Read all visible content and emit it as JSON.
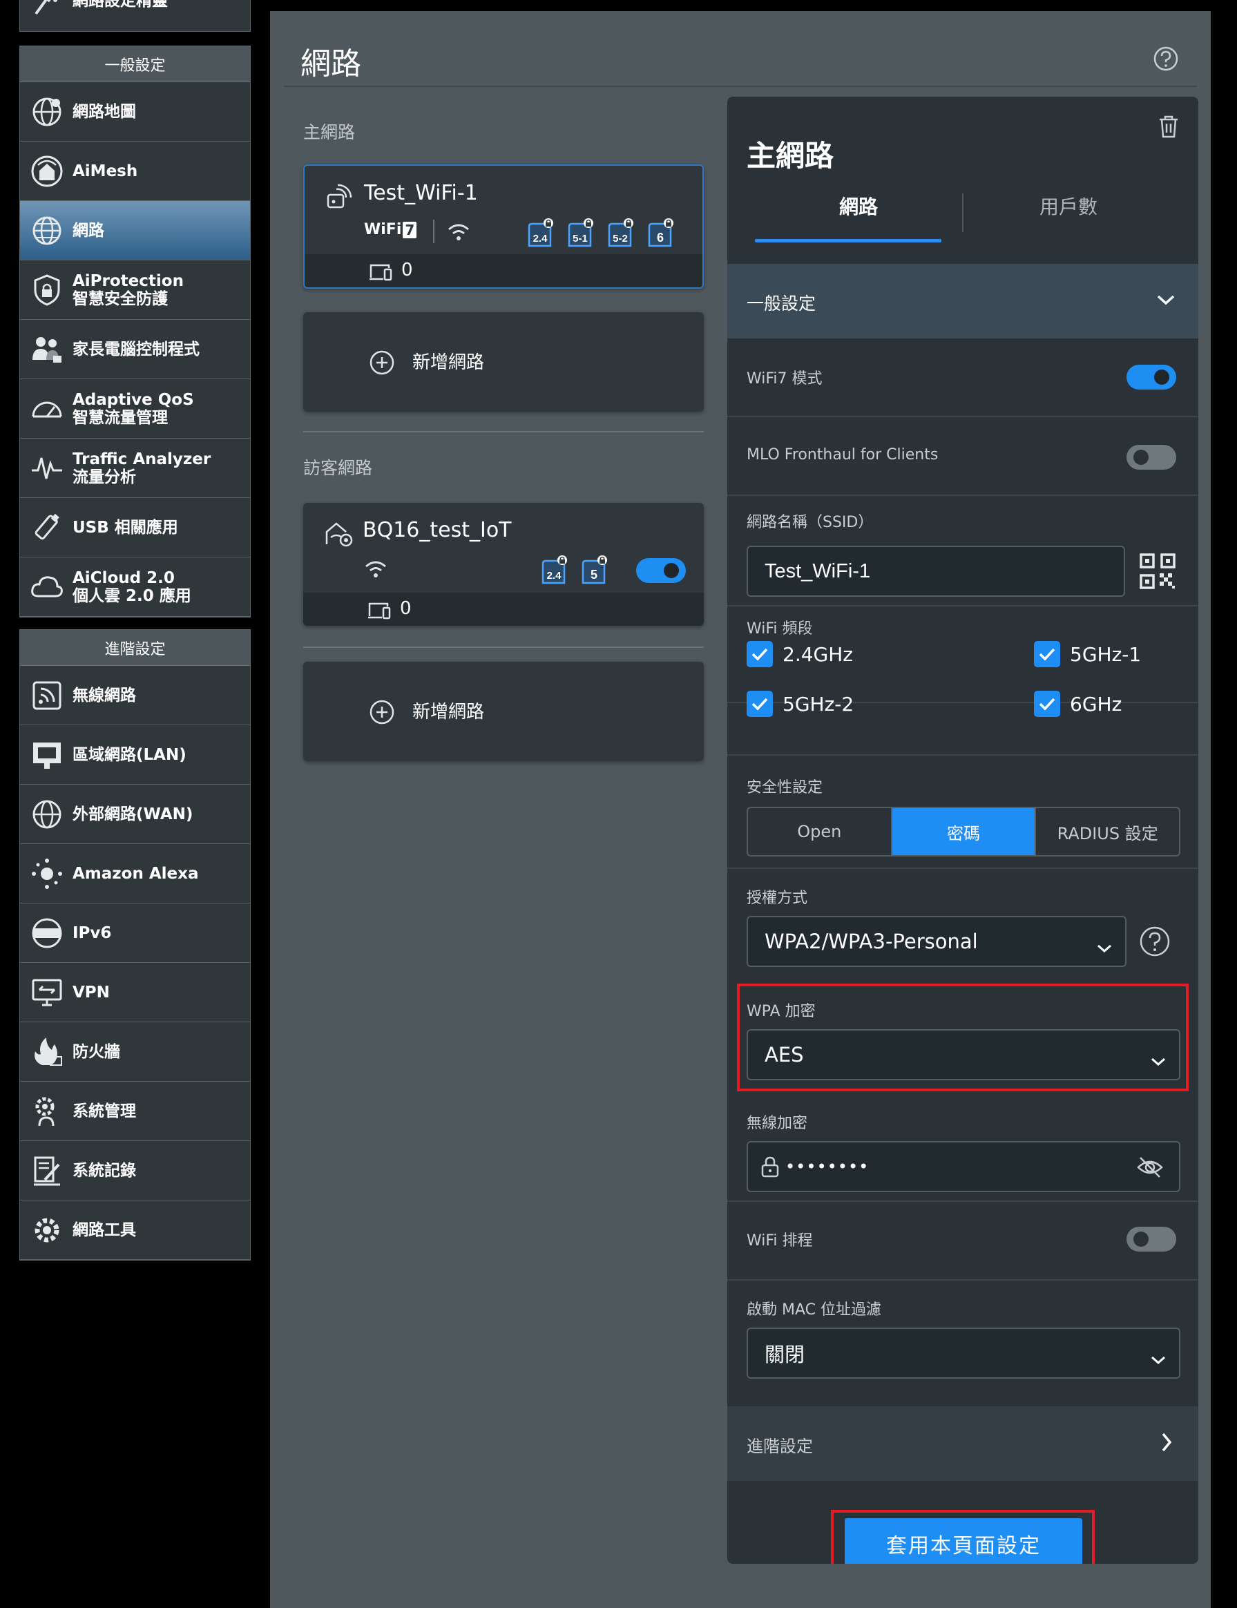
{
  "sidebar": {
    "top_partial_label": "網路設定精靈",
    "general_header": "一般設定",
    "general_items": [
      {
        "label": "網路地圖",
        "label2": ""
      },
      {
        "label": "AiMesh",
        "label2": ""
      },
      {
        "label": "網路",
        "label2": ""
      },
      {
        "label": "AiProtection",
        "label2": "智慧安全防護"
      },
      {
        "label": "家長電腦控制程式",
        "label2": ""
      },
      {
        "label": "Adaptive QoS",
        "label2": "智慧流量管理"
      },
      {
        "label": "Traffic Analyzer",
        "label2": "流量分析"
      },
      {
        "label": "USB 相關應用",
        "label2": ""
      },
      {
        "label": "AiCloud 2.0",
        "label2": "個人雲 2.0 應用"
      }
    ],
    "advanced_header": "進階設定",
    "advanced_items": [
      {
        "label": "無線網路"
      },
      {
        "label": "區域網路(LAN)"
      },
      {
        "label": "外部網路(WAN)"
      },
      {
        "label": "Amazon Alexa"
      },
      {
        "label": "IPv6"
      },
      {
        "label": "VPN"
      },
      {
        "label": "防火牆"
      },
      {
        "label": "系統管理"
      },
      {
        "label": "系統記錄"
      },
      {
        "label": "網路工具"
      }
    ]
  },
  "main": {
    "title": "網路",
    "main_network_label": "主網路",
    "guest_network_label": "訪客網路",
    "add_network_label": "新增網路",
    "main_card": {
      "ssid": "Test_WiFi-1",
      "wifi_badge": "WiFi",
      "wifi_badge_num": "7",
      "bands": [
        "2.4",
        "5-1",
        "5-2",
        "6"
      ],
      "client_count": "0"
    },
    "guest_card": {
      "ssid": "BQ16_test_IoT",
      "bands": [
        "2.4",
        "5"
      ],
      "client_count": "0",
      "enabled": true
    }
  },
  "settings": {
    "title": "主網路",
    "tab_network": "網路",
    "tab_users": "用戶數",
    "general_section": "一般設定",
    "wifi7_mode_label": "WiFi7 模式",
    "wifi7_mode_on": true,
    "mlo_label": "MLO Fronthaul for Clients",
    "mlo_on": false,
    "ssid_label": "網路名稱（SSID）",
    "ssid_value": "Test_WiFi-1",
    "band_label": "WiFi 頻段",
    "band_options": [
      "2.4GHz",
      "5GHz-1",
      "5GHz-2",
      "6GHz"
    ],
    "security_label": "安全性設定",
    "security_options": [
      "Open",
      "密碼",
      "RADIUS 設定"
    ],
    "auth_label": "授權方式",
    "auth_value": "WPA2/WPA3-Personal",
    "wpa_label": "WPA 加密",
    "wpa_value": "AES",
    "wireless_key_label": "無線加密",
    "wireless_key_value": "••••••••",
    "schedule_label": "WiFi 排程",
    "schedule_on": false,
    "mac_filter_label": "啟動 MAC 位址過濾",
    "mac_filter_value": "關閉",
    "advanced_label": "進階設定",
    "apply_label": "套用本頁面設定"
  },
  "colors": {
    "accent": "#1f8ef4",
    "highlight": "#e41c23",
    "panel": "#2a3237"
  }
}
